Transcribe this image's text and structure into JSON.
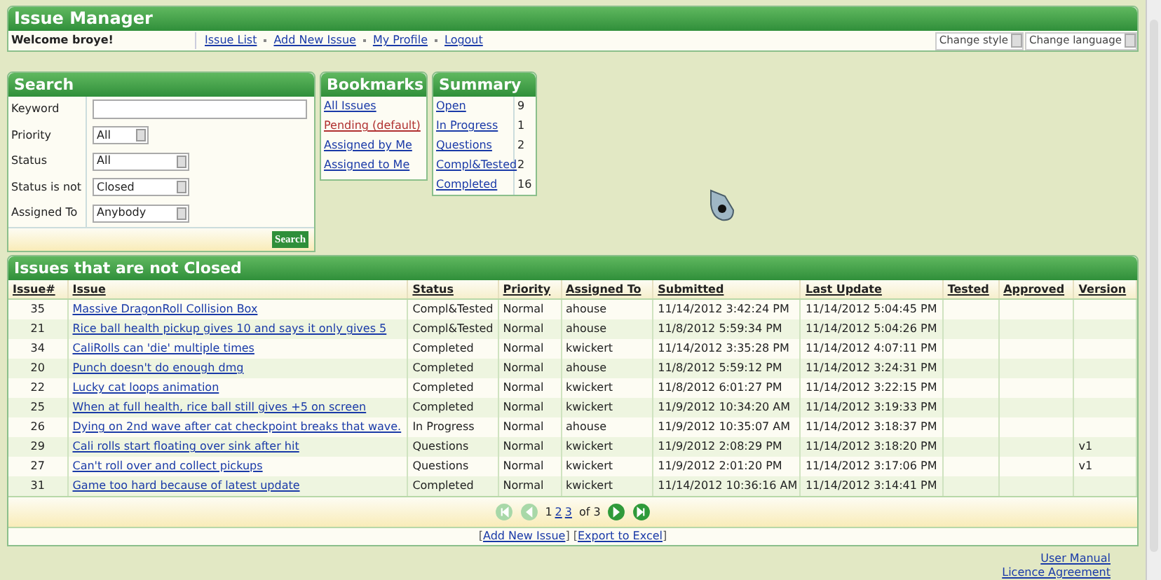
{
  "header": {
    "title": "Issue Manager",
    "welcome": "Welcome broye!",
    "nav": [
      "Issue List",
      "Add New Issue",
      "My Profile",
      "Logout"
    ],
    "menus": [
      "Change style",
      "Change language"
    ]
  },
  "search": {
    "title": "Search",
    "fields": [
      {
        "label": "Keyword",
        "kind": "text"
      },
      {
        "label": "Priority",
        "kind": "short_select",
        "value": "All"
      },
      {
        "label": "Status",
        "kind": "select",
        "value": "All"
      },
      {
        "label": "Status is not",
        "kind": "select",
        "value": "Closed"
      },
      {
        "label": "Assigned To",
        "kind": "select",
        "value": "Anybody"
      }
    ],
    "button": "Search"
  },
  "bookmarks": {
    "title": "Bookmarks",
    "items": [
      {
        "label": "All Issues",
        "selected": false
      },
      {
        "label": "Pending (default)",
        "selected": true
      },
      {
        "label": "Assigned by Me",
        "selected": false
      },
      {
        "label": "Assigned to Me",
        "selected": false
      }
    ]
  },
  "summary": {
    "title": "Summary",
    "items": [
      {
        "label": "Open",
        "count": "9"
      },
      {
        "label": "In Progress",
        "count": "1"
      },
      {
        "label": "Questions",
        "count": "2"
      },
      {
        "label": "Compl&Tested",
        "count": "2"
      },
      {
        "label": "Completed",
        "count": "16"
      }
    ]
  },
  "issues": {
    "title": "Issues that are not Closed",
    "columns": [
      "Issue#",
      "Issue",
      "Status",
      "Priority",
      "Assigned To",
      "Submitted",
      "Last Update",
      "Tested",
      "Approved",
      "Version"
    ],
    "rows": [
      {
        "id": "35",
        "issue": "Massive DragonRoll Collision Box",
        "status": "Compl&Tested",
        "priority": "Normal",
        "assigned_to": "ahouse",
        "submitted": "11/14/2012 3:42:24 PM",
        "last_update": "11/14/2012 5:04:45 PM"
      },
      {
        "id": "21",
        "issue": "Rice ball health pickup gives 10 and says it only gives 5",
        "status": "Compl&Tested",
        "priority": "Normal",
        "assigned_to": "ahouse",
        "submitted": "11/8/2012 5:59:34 PM",
        "last_update": "11/14/2012 5:04:26 PM"
      },
      {
        "id": "34",
        "issue": "CaliRolls can 'die' multiple times",
        "status": "Completed",
        "priority": "Normal",
        "assigned_to": "kwickert",
        "submitted": "11/14/2012 3:35:28 PM",
        "last_update": "11/14/2012 4:07:11 PM"
      },
      {
        "id": "20",
        "issue": "Punch doesn't do enough dmg",
        "status": "Completed",
        "priority": "Normal",
        "assigned_to": "ahouse",
        "submitted": "11/8/2012 5:59:12 PM",
        "last_update": "11/14/2012 3:24:31 PM"
      },
      {
        "id": "22",
        "issue": "Lucky cat loops animation",
        "status": "Completed",
        "priority": "Normal",
        "assigned_to": "kwickert",
        "submitted": "11/8/2012 6:01:27 PM",
        "last_update": "11/14/2012 3:22:15 PM"
      },
      {
        "id": "25",
        "issue": "When at full health, rice ball still gives +5 on screen",
        "status": "Completed",
        "priority": "Normal",
        "assigned_to": "kwickert",
        "submitted": "11/9/2012 10:34:20 AM",
        "last_update": "11/14/2012 3:19:33 PM"
      },
      {
        "id": "26",
        "issue": "Dying on 2nd wave after cat checkpoint breaks that wave.",
        "status": "In Progress",
        "priority": "Normal",
        "assigned_to": "ahouse",
        "submitted": "11/9/2012 10:35:07 AM",
        "last_update": "11/14/2012 3:18:37 PM"
      },
      {
        "id": "29",
        "issue": "Cali rolls start floating over sink after hit",
        "status": "Questions",
        "priority": "Normal",
        "assigned_to": "kwickert",
        "submitted": "11/9/2012 2:08:29 PM",
        "last_update": "11/14/2012 3:18:20 PM",
        "version": "v1"
      },
      {
        "id": "27",
        "issue": "Can't roll over and collect pickups",
        "status": "Questions",
        "priority": "Normal",
        "assigned_to": "kwickert",
        "submitted": "11/9/2012 2:01:20 PM",
        "last_update": "11/14/2012 3:17:06 PM",
        "version": "v1"
      },
      {
        "id": "31",
        "issue": "Game too hard because of latest update",
        "status": "Completed",
        "priority": "Normal",
        "assigned_to": "kwickert",
        "submitted": "11/14/2012 10:36:16 AM",
        "last_update": "11/14/2012 3:14:41 PM"
      }
    ],
    "pager": {
      "buttons_before": [
        {
          "kind": "first",
          "disabled": true
        },
        {
          "kind": "prev",
          "disabled": true
        }
      ],
      "pages": [
        {
          "label": "1",
          "selected": true
        },
        {
          "label": "2",
          "selected": false
        },
        {
          "label": "3",
          "selected": false
        }
      ],
      "total": "of 3",
      "buttons_after": [
        {
          "kind": "next",
          "disabled": false
        },
        {
          "kind": "last",
          "disabled": false
        }
      ]
    },
    "actions": [
      {
        "kind": "text",
        "text": "["
      },
      {
        "kind": "link",
        "text": "Add New Issue"
      },
      {
        "kind": "text",
        "text": "] ["
      },
      {
        "kind": "link",
        "text": "Export to Excel"
      },
      {
        "kind": "text",
        "text": "]"
      }
    ]
  },
  "footer_links": [
    "User Manual",
    "Licence Agreement"
  ]
}
